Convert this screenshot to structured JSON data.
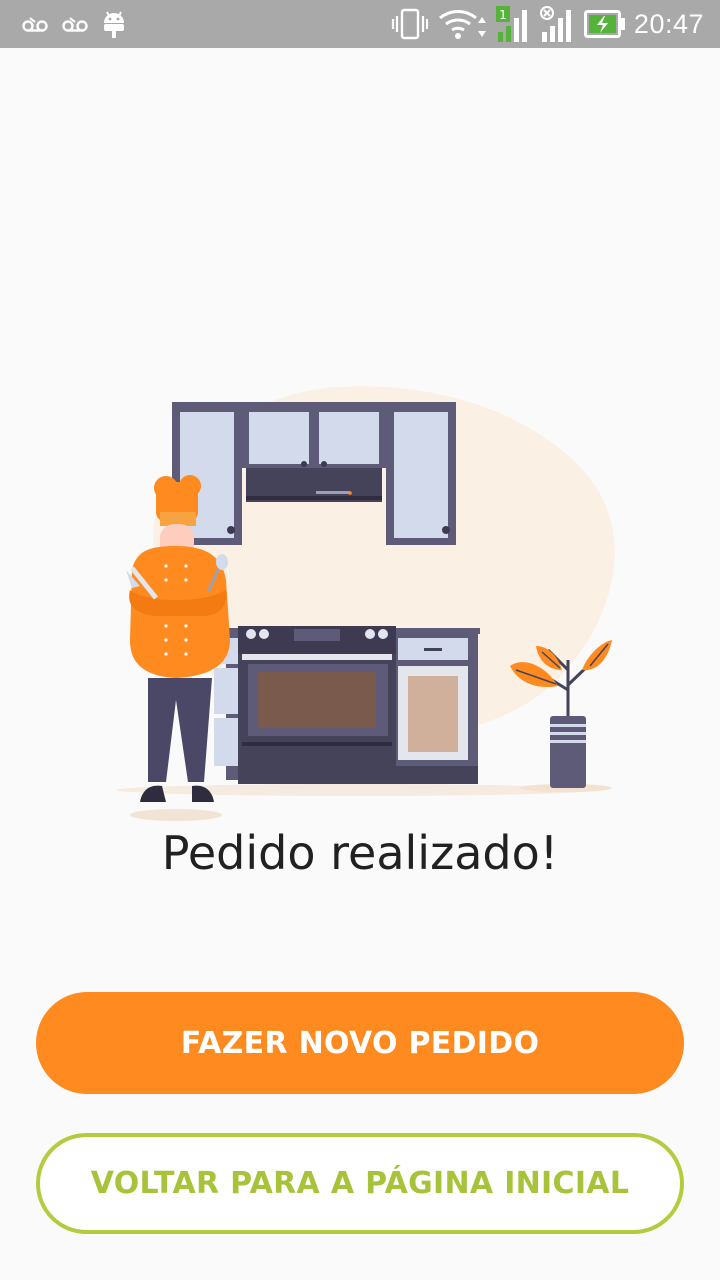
{
  "status_bar": {
    "time": "20:47",
    "sim_badge": "1",
    "icons": [
      "voicemail-icon",
      "voicemail-icon",
      "android-icon",
      "vibrate-icon",
      "wifi-icon",
      "signal-sim1-icon",
      "signal-sim2-no-service-icon",
      "battery-charging-icon"
    ]
  },
  "main": {
    "title": "Pedido realizado!"
  },
  "actions": {
    "new_order_label": "FAZER NOVO PEDIDO",
    "home_label": "VOLTAR PARA A PÁGINA INICIAL"
  },
  "colors": {
    "primary": "#ff8a1f",
    "secondary": "#b3cc3e",
    "status_bar": "#a9a9a9",
    "background": "#fafafa"
  }
}
